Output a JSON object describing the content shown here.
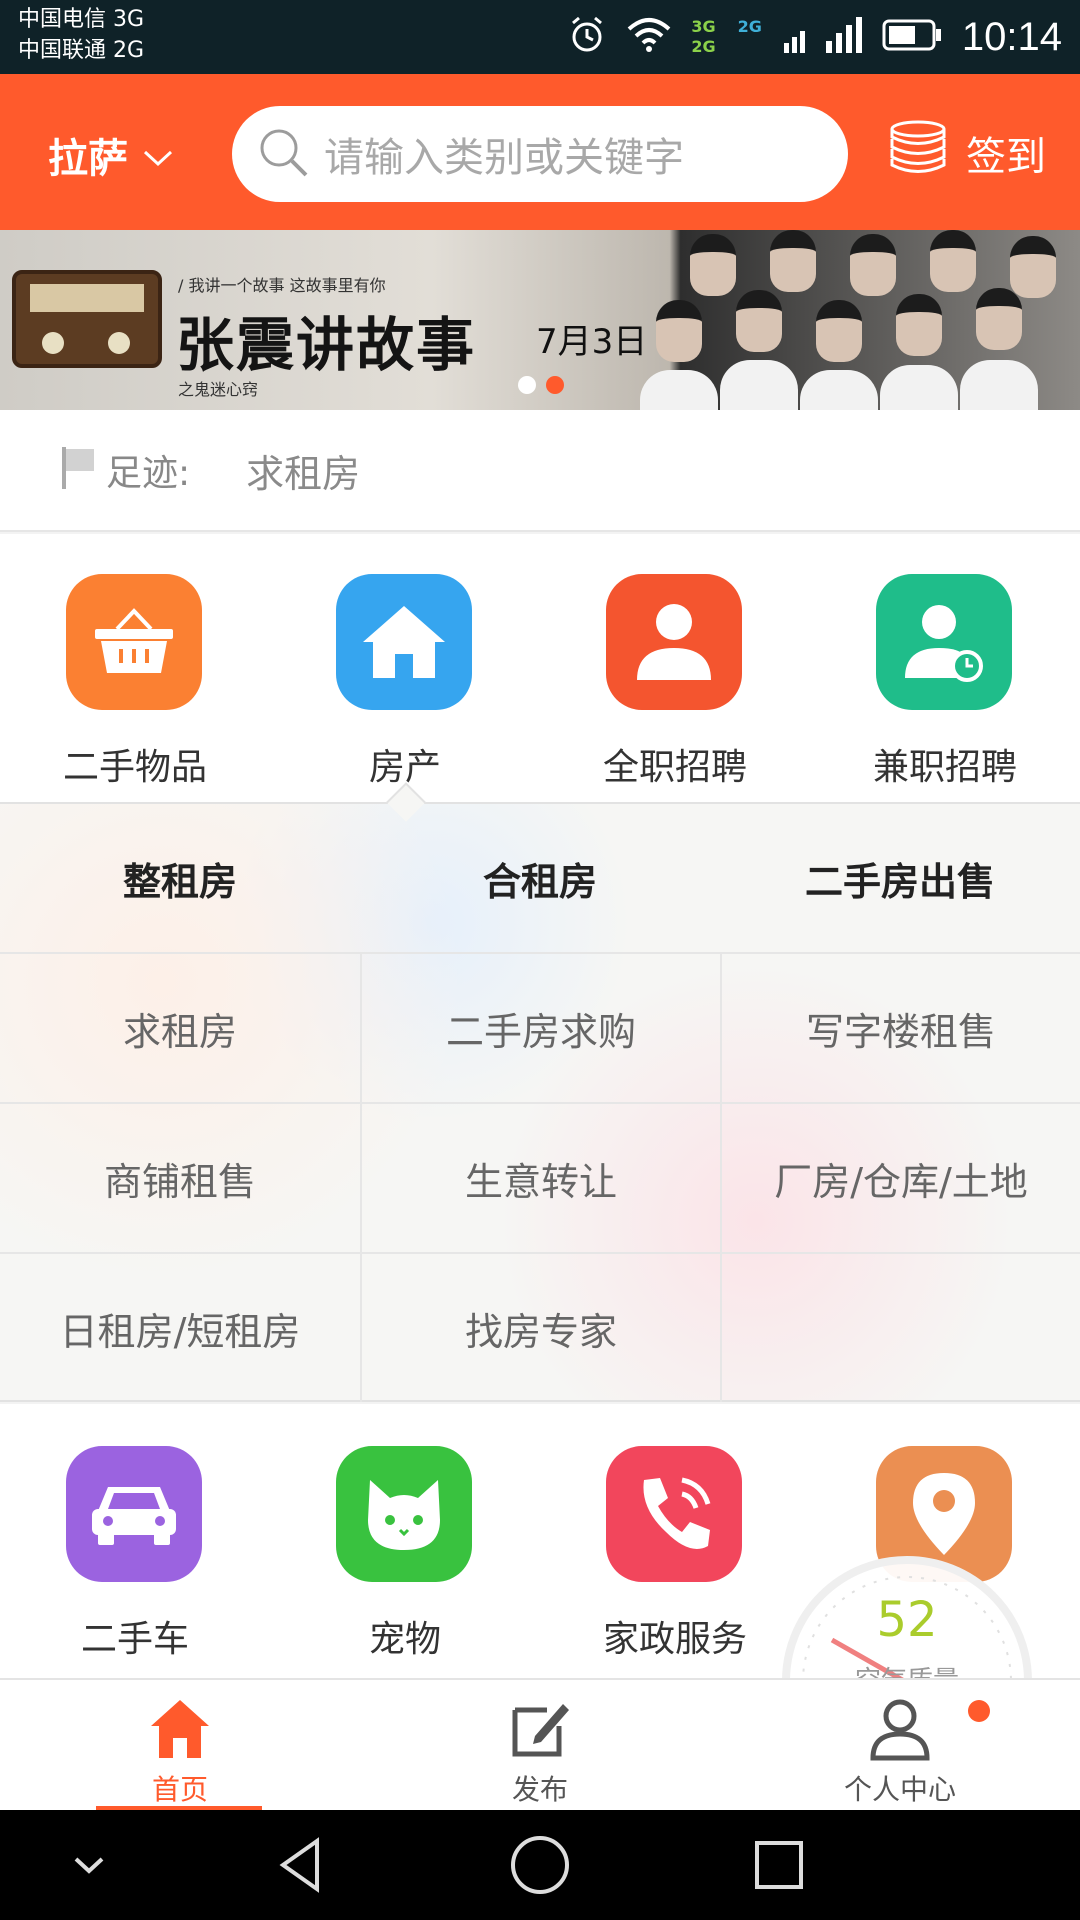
{
  "status_bar": {
    "carrier1": "中国电信 3G",
    "carrier2": "中国联通 2G",
    "net_label_top": "3G",
    "net_label_top2": "2G",
    "net_label_bottom": "2G",
    "time": "10:14"
  },
  "header": {
    "city": "拉萨",
    "search_placeholder": "请输入类别或关键字",
    "signin_label": "签到"
  },
  "banner": {
    "subtitle": "/ 我讲一个故事 这故事里有你",
    "title": "张震讲故事",
    "date": "7月3日",
    "tagline": "之鬼迷心窍",
    "radio_text": "张震讲故事",
    "active_slide": 2,
    "slide_count": 2
  },
  "footprint": {
    "label": "足迹:",
    "item": "求租房"
  },
  "categories_top": [
    {
      "label": "二手物品",
      "color": "#fb8032",
      "icon": "basket-icon"
    },
    {
      "label": "房产",
      "color": "#36a5ef",
      "icon": "house-icon"
    },
    {
      "label": "全职招聘",
      "color": "#f4552f",
      "icon": "person-icon"
    },
    {
      "label": "兼职招聘",
      "color": "#1fbd8a",
      "icon": "person-clock-icon"
    }
  ],
  "subpanel": {
    "headers": [
      "整租房",
      "合租房",
      "二手房出售"
    ],
    "rows": [
      [
        "求租房",
        "二手房求购",
        "写字楼租售"
      ],
      [
        "商铺租售",
        "生意转让",
        "厂房/仓库/土地"
      ],
      [
        "日租房/短租房",
        "找房专家",
        ""
      ]
    ]
  },
  "categories_bottom": [
    {
      "label": "二手车",
      "color": "#9b63e0",
      "icon": "car-icon"
    },
    {
      "label": "宠物",
      "color": "#39c23f",
      "icon": "cat-icon"
    },
    {
      "label": "家政服务",
      "color": "#f2465c",
      "icon": "phone-icon"
    },
    {
      "label": "",
      "color": "#eb8f52",
      "icon": "location-pin-icon"
    }
  ],
  "air_quality": {
    "value": "52",
    "label": "空气质量"
  },
  "bottom_nav": {
    "home": "首页",
    "publish": "发布",
    "profile": "个人中心",
    "active_color": "#ff5a2c",
    "inactive_color": "#555555"
  }
}
